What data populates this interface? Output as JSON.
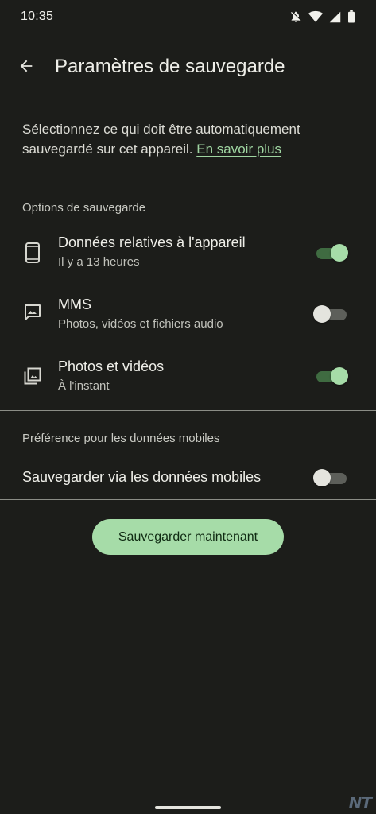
{
  "status_bar": {
    "time": "10:35",
    "icons": [
      "notifications-off-icon",
      "wifi-icon",
      "signal-icon",
      "battery-icon"
    ]
  },
  "app_bar": {
    "back_icon": "arrow-back-icon",
    "title": "Paramètres de sauvegarde"
  },
  "intro": {
    "text": "Sélectionnez ce qui doit être automatiquement sauvegardé sur cet appareil. ",
    "link_label": "En savoir plus"
  },
  "backup_options": {
    "header": "Options de sauvegarde",
    "items": [
      {
        "icon": "phone-icon",
        "title": "Données relatives à l'appareil",
        "subtitle": "Il y a 13 heures",
        "enabled": true
      },
      {
        "icon": "mms-icon",
        "title": "MMS",
        "subtitle": "Photos, vidéos et fichiers audio",
        "enabled": false
      },
      {
        "icon": "photo-library-icon",
        "title": "Photos et vidéos",
        "subtitle": "À l'instant",
        "enabled": true
      }
    ]
  },
  "mobile_data": {
    "header": "Préférence pour les données mobiles",
    "label": "Sauvegarder via les données mobiles",
    "enabled": false
  },
  "backup_button": {
    "label": "Sauvegarder maintenant"
  },
  "watermark": "NT",
  "colors": {
    "background": "#1c1d1a",
    "accent": "#a6dca8",
    "link": "#9fd5a1",
    "toggle_on_track": "#3f6b41",
    "toggle_off_track": "#5d5f5a",
    "divider": "#8b8d86"
  }
}
